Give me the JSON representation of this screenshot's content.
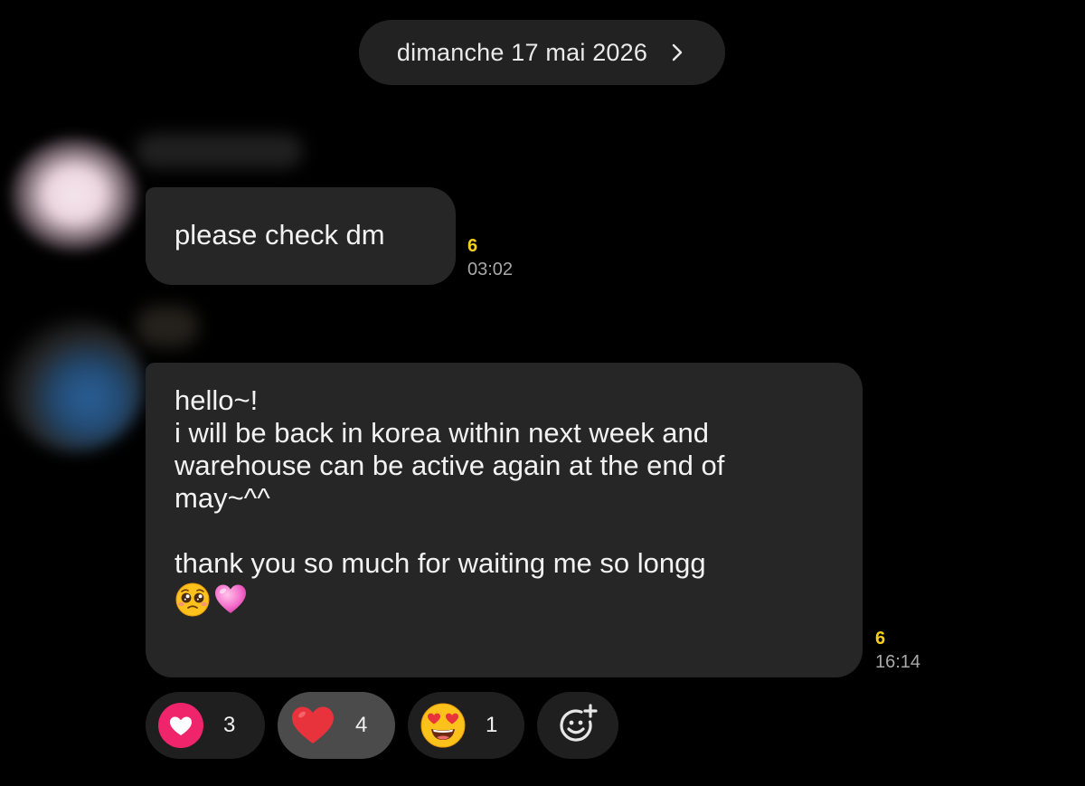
{
  "date_separator": {
    "label": "dimanche 17 mai 2026",
    "icon": "chevron-right-icon"
  },
  "messages": [
    {
      "text_lines": [
        "please check dm"
      ],
      "unread_count": "6",
      "time": "03:02"
    },
    {
      "text_lines": [
        "hello~!",
        "i will be back in korea within next week and",
        "warehouse can be active again at the end of",
        "may~^^",
        "",
        "thank you so much for waiting me so longg"
      ],
      "emojis": [
        "pleading-face-icon",
        "pink-heart-icon"
      ],
      "unread_count": "6",
      "time": "16:14"
    }
  ],
  "reactions": [
    {
      "icon": "heart-badge-icon",
      "count": "3",
      "selected": false
    },
    {
      "icon": "red-heart-icon",
      "count": "4",
      "selected": true
    },
    {
      "icon": "heart-eyes-face-icon",
      "count": "1",
      "selected": false
    }
  ],
  "add_reaction": {
    "icon": "add-reaction-icon"
  },
  "colors": {
    "background": "#000000",
    "bubble": "#262626",
    "pill": "#222222",
    "unread_count": "#f5cf1c",
    "time": "#a8a8a8",
    "reaction_selected": "#4b4b4b",
    "heart_badge": "#f0246a",
    "heart": "#e8323c"
  }
}
